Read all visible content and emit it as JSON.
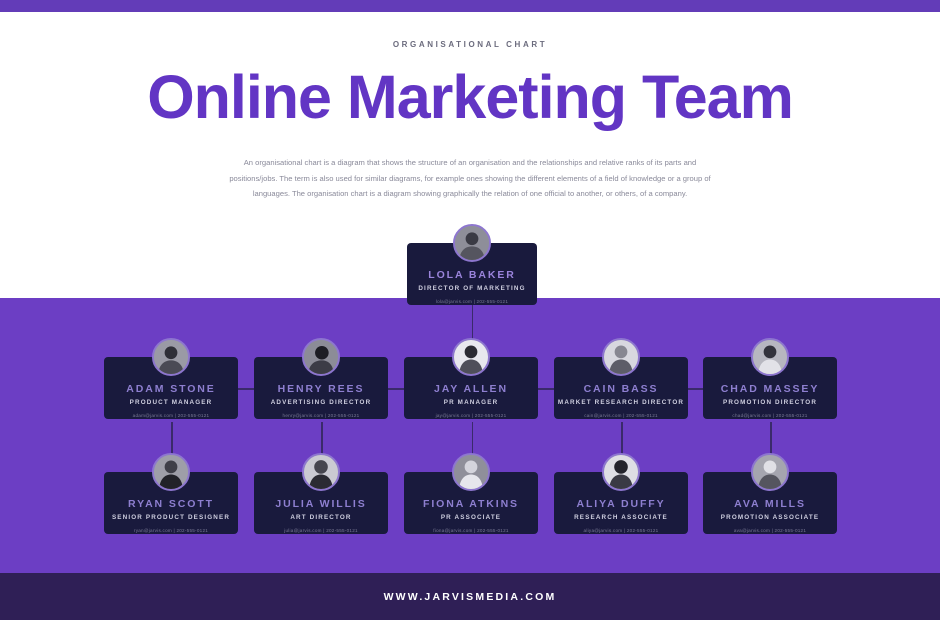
{
  "top_bar": {
    "color": "#633cb8"
  },
  "header": {
    "eyebrow": "ORGANISATIONAL CHART",
    "title": "Online Marketing Team",
    "intro": "An organisational chart is a diagram that shows the structure of an organisation and the relationships and relative ranks of its parts and positions/jobs. The term is also used for similar diagrams, for example ones showing the different elements of a field of knowledge or a group of languages.  The organisation chart is a diagram showing graphically the relation  of one official to another, or others, of a company."
  },
  "colors": {
    "accent_purple": "#6235c4",
    "band_purple": "#6c3ec4",
    "card_navy": "#191a3d",
    "footer_navy": "#2f1f56",
    "name_text": "#8e7fd0",
    "avatar_ring": "#8d76cf"
  },
  "chart_data": {
    "type": "diagram",
    "title": "Online Marketing Team",
    "root": {
      "name": "LOLA BAKER",
      "role": "DIRECTOR OF MARKETING",
      "contact": "lola@jarvis.com | 202-555-0121",
      "avatar_icon": "person-avatar"
    },
    "level2": [
      {
        "name": "ADAM STONE",
        "role": "PRODUCT MANAGER",
        "contact": "adam@jarvis.com | 202-555-0121",
        "avatar_icon": "person-avatar"
      },
      {
        "name": "HENRY REES",
        "role": "ADVERTISING DIRECTOR",
        "contact": "henry@jarvis.com | 202-555-0121",
        "avatar_icon": "person-avatar"
      },
      {
        "name": "JAY ALLEN",
        "role": "PR MANAGER",
        "contact": "jay@jarvis.com | 202-555-0121",
        "avatar_icon": "person-avatar"
      },
      {
        "name": "CAIN BASS",
        "role": "MARKET RESEARCH DIRECTOR",
        "contact": "cain@jarvis.com | 202-555-0121",
        "avatar_icon": "person-avatar"
      },
      {
        "name": "CHAD MASSEY",
        "role": "PROMOTION DIRECTOR",
        "contact": "chad@jarvis.com | 202-555-0121",
        "avatar_icon": "person-avatar"
      }
    ],
    "level3": [
      {
        "name": "RYAN SCOTT",
        "role": "SENIOR PRODUCT DESIGNER",
        "contact": "ryan@jarvis.com | 202-555-0121",
        "avatar_icon": "person-avatar"
      },
      {
        "name": "JULIA WILLIS",
        "role": "ART DIRECTOR",
        "contact": "julia@jarvis.com | 202-555-0121",
        "avatar_icon": "person-avatar"
      },
      {
        "name": "FIONA ATKINS",
        "role": "PR ASSOCIATE",
        "contact": "fiona@jarvis.com | 202-555-0121",
        "avatar_icon": "person-avatar"
      },
      {
        "name": "ALIYA DUFFY",
        "role": "RESEARCH ASSOCIATE",
        "contact": "aliya@jarvis.com | 202-555-0121",
        "avatar_icon": "person-avatar"
      },
      {
        "name": "AVA MILLS",
        "role": "PROMOTION ASSOCIATE",
        "contact": "ava@jarvis.com | 202-555-0121",
        "avatar_icon": "person-avatar"
      }
    ]
  },
  "footer": {
    "url": "WWW.JARVISMEDIA.COM"
  }
}
